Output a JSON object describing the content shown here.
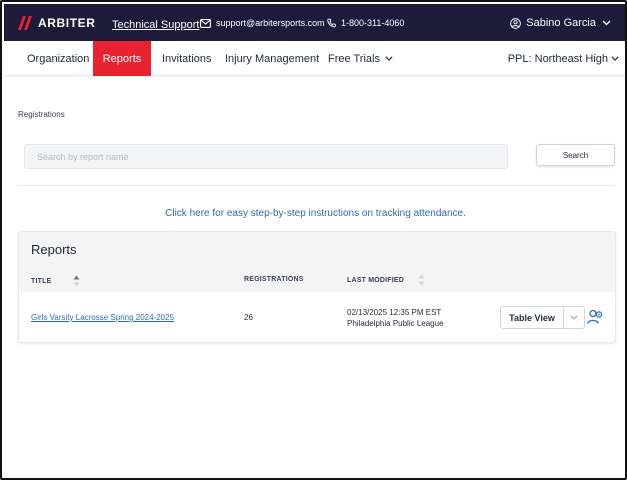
{
  "header": {
    "logo_text": "ARBITER",
    "tech_support": "Technical Support",
    "email": "support@arbitersports.com",
    "phone": "1-800-311-4060",
    "user_name": "Sabino Garcia"
  },
  "nav": {
    "items": [
      {
        "label": "Organization"
      },
      {
        "label": "Reports"
      },
      {
        "label": "Invitations"
      },
      {
        "label": "Injury Management"
      },
      {
        "label": "Free Trials"
      }
    ],
    "org_select": "PPL: Northeast High"
  },
  "breadcrumb": "Registrations",
  "search": {
    "placeholder": "Search by report name",
    "button_label": "Search"
  },
  "instructions_link": "Click here for easy step-by-step instructions on tracking attendance.",
  "reports": {
    "title": "Reports",
    "columns": [
      "TITLE",
      "REGISTRATIONS",
      "LAST MODIFIED"
    ],
    "rows": [
      {
        "title": "Girls Varsity Lacrosse Spring 2024-2025",
        "registrations": "26",
        "last_modified": "02/13/2025 12:35 PM EST",
        "league": "Philadelphia Public League",
        "action_label": "Table View"
      }
    ]
  },
  "colors": {
    "topbar": "#1e1b3a",
    "active_tab": "#e8222e",
    "link": "#2b6cb0"
  }
}
